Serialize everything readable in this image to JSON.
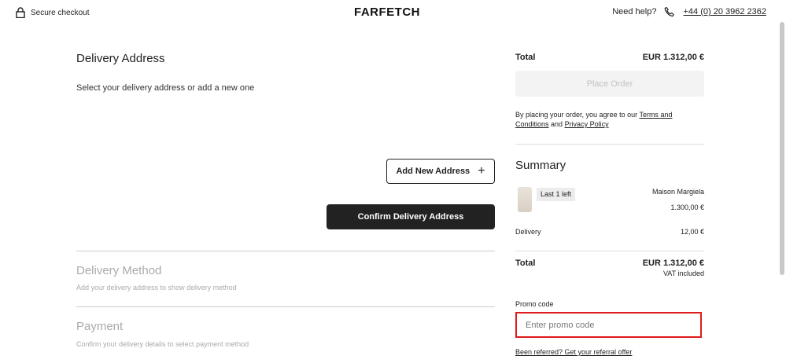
{
  "header": {
    "secure_label": "Secure checkout",
    "logo": "FARFETCH",
    "help_label": "Need help?",
    "phone": "+44 (0) 20 3962 2362"
  },
  "delivery_address": {
    "title": "Delivery Address",
    "subtitle": "Select your delivery address or add a new one",
    "add_new_label": "Add New Address",
    "confirm_label": "Confirm Delivery Address"
  },
  "delivery_method": {
    "title": "Delivery Method",
    "subtitle": "Add your delivery address to show delivery method"
  },
  "payment": {
    "title": "Payment",
    "subtitle": "Confirm your delivery details to select payment method"
  },
  "order": {
    "total_label": "Total",
    "total_value": "EUR 1.312,00 €",
    "place_order_label": "Place Order",
    "terms_prefix": "By placing your order, you agree to our ",
    "terms_link": "Terms and Conditions",
    "terms_and": " and ",
    "privacy_link": "Privacy Policy"
  },
  "summary": {
    "title": "Summary",
    "item": {
      "badge": "Last 1 left",
      "brand": "Maison Margiela",
      "price": "1.300,00 €"
    },
    "delivery_label": "Delivery",
    "delivery_value": "12,00 €",
    "total_label": "Total",
    "total_value": "EUR 1.312,00 €",
    "vat_note": "VAT included"
  },
  "promo": {
    "label": "Promo code",
    "placeholder": "Enter promo code",
    "referral_link": "Been referred? Get your referral offer"
  },
  "icons": {
    "lock": "lock-icon",
    "phone": "phone-icon",
    "plus": "plus-icon"
  },
  "colors": {
    "primary": "#222222",
    "focus_border": "#e01b1b",
    "disabled_bg": "#f3f3f3",
    "muted_text": "#aaaaaa"
  }
}
